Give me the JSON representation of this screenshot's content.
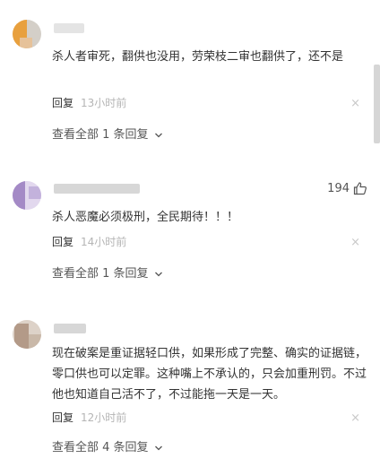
{
  "comments": [
    {
      "text": "杀人者审死，翻供也没用，劳荣枝二审也翻供了，还不是",
      "reply_label": "回复",
      "time": "13小时前",
      "view_all": "查看全部 1 条回复",
      "close_label": "×"
    },
    {
      "likes": "194",
      "text": "杀人恶魔必须极刑，全民期待！！！",
      "reply_label": "回复",
      "time": "14小时前",
      "view_all": "查看全部 1 条回复",
      "close_label": "×"
    },
    {
      "text": "现在破案是重证据轻口供，如果形成了完整、确实的证据链，零口供也可以定罪。这种嘴上不承认的，只会加重刑罚。不过他也知道自己活不了，不过能拖一天是一天。",
      "reply_label": "回复",
      "time": "12小时前",
      "view_all": "查看全部 4 条回复",
      "close_label": "×"
    }
  ],
  "colors": {
    "text": "#333333",
    "meta": "#b5b5b5",
    "link": "#555555",
    "avatar1": [
      "#e8a03e",
      "#d4cfc8"
    ],
    "avatar2": [
      "#a48ac6",
      "#e2d8ee"
    ],
    "avatar3": [
      "#b39a88",
      "#ddd2c8"
    ]
  },
  "icons": {
    "like": "thumbs-up-icon",
    "chevron": "chevron-down-icon",
    "close": "close-icon"
  }
}
